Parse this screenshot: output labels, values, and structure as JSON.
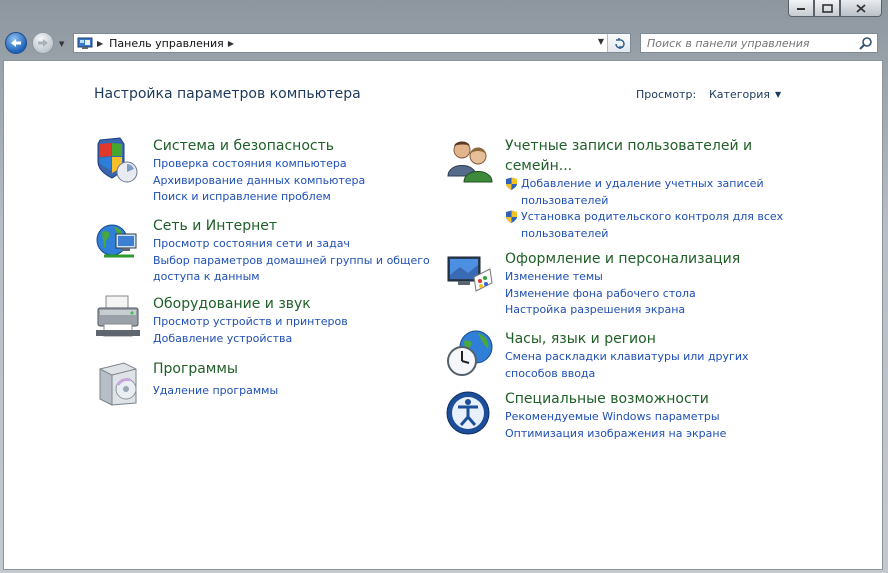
{
  "nav": {
    "breadcrumb": "Панель управления",
    "search_placeholder": "Поиск в панели управления"
  },
  "page": {
    "heading": "Настройка параметров компьютера",
    "view_label": "Просмотр:",
    "view_value": "Категория"
  },
  "categories": [
    {
      "title": "Система и безопасность",
      "links": [
        "Проверка состояния компьютера",
        "Архивирование данных компьютера",
        "Поиск и исправление проблем"
      ]
    },
    {
      "title": "Сеть и Интернет",
      "links": [
        "Просмотр состояния сети и задач",
        "Выбор параметров домашней группы и общего",
        "доступа к данным"
      ]
    },
    {
      "title": "Оборудование и звук",
      "links": [
        "Просмотр устройств и принтеров",
        "Добавление устройства"
      ]
    },
    {
      "title": "Программы",
      "links": [
        "Удаление программы"
      ]
    },
    {
      "title_line1": "Учетные записи пользователей и",
      "title_line2": "семейн...",
      "links": [
        "Добавление и удаление учетных записей",
        "пользователей",
        "Установка родительского контроля для всех",
        "пользователей"
      ]
    },
    {
      "title": "Оформление и персонализация",
      "links": [
        "Изменение темы",
        "Изменение фона рабочего стола",
        "Настройка разрешения экрана"
      ]
    },
    {
      "title": "Часы, язык и регион",
      "links": [
        "Смена раскладки клавиатуры или других",
        "способов ввода"
      ]
    },
    {
      "title": "Специальные возможности",
      "links": [
        "Рекомендуемые Windows параметры",
        "Оптимизация изображения на экране"
      ]
    }
  ],
  "icons": {
    "back": "back-arrow-icon",
    "forward": "forward-arrow-icon",
    "control_panel": "control-panel-icon",
    "refresh": "refresh-icon",
    "search": "search-icon",
    "system_security": "shield-windows-icon",
    "network": "globe-network-icon",
    "hardware": "printer-icon",
    "programs": "programs-box-icon",
    "users": "users-icon",
    "appearance": "monitor-palette-icon",
    "clock": "clock-globe-icon",
    "ease": "ease-of-access-icon",
    "uac_shield": "uac-shield-icon"
  },
  "colors": {
    "category_title": "#1f5f28",
    "link": "#1f4fb5",
    "heading": "#1e3a5a"
  }
}
